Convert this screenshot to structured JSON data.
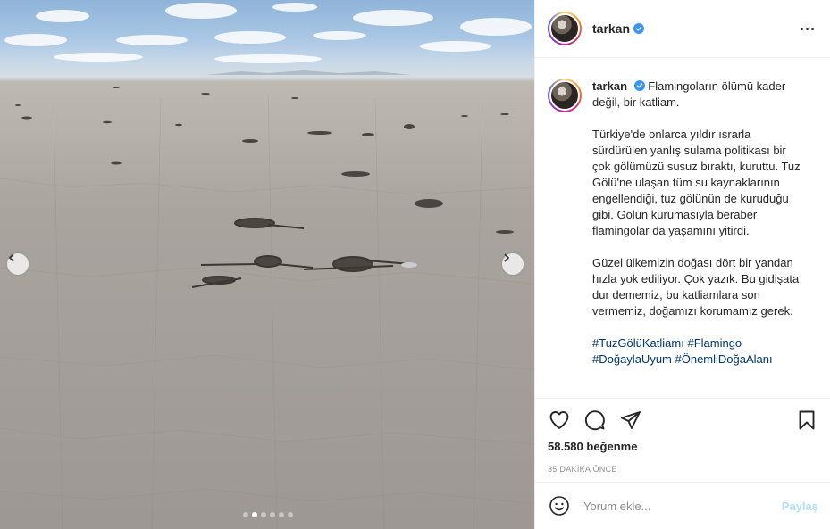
{
  "post": {
    "username": "tarkan",
    "caption_lead": "Flamingoların ölümü kader değil, bir katliam.",
    "paragraphs": [
      "Türkiye'de onlarca yıldır ısrarla sürdürülen yanlış sulama politikası bir çok gölümüzü susuz bıraktı, kuruttu. Tuz Gölü'ne ulaşan tüm su kaynaklarının engellendiği, tuz gölünün de kuruduğu gibi. Gölün kurumasıyla beraber flamingolar da yaşamını yitirdi.",
      "Güzel ülkemizin doğası dört bir yandan hızla yok ediliyor. Çok yazık. Bu gidişata dur dememiz, bu katliamlara son vermemiz, doğamızı korumamız gerek."
    ],
    "hashtags": [
      "#TuzGölüKatliamı",
      "#Flamingo",
      "#DoğaylaUyum",
      "#ÖnemliDoğaAlanı"
    ],
    "likes": "58.580 beğenme",
    "time": "35 DAKİKA ÖNCE"
  },
  "carousel": {
    "slide_count": 6,
    "active_index": 1
  },
  "comment": {
    "placeholder": "Yorum ekle...",
    "post_label": "Paylaş"
  },
  "icons": {
    "more": "more-options-icon",
    "prev": "chevron-left-icon",
    "next": "chevron-right-icon",
    "like": "heart-icon",
    "comment": "comment-icon",
    "share": "paper-plane-icon",
    "save": "bookmark-icon",
    "emoji": "smiley-icon",
    "verified": "verified-badge-icon"
  },
  "colors": {
    "verified": "#3897f0",
    "link": "#00376b",
    "post_disabled": "#b2dffc"
  }
}
